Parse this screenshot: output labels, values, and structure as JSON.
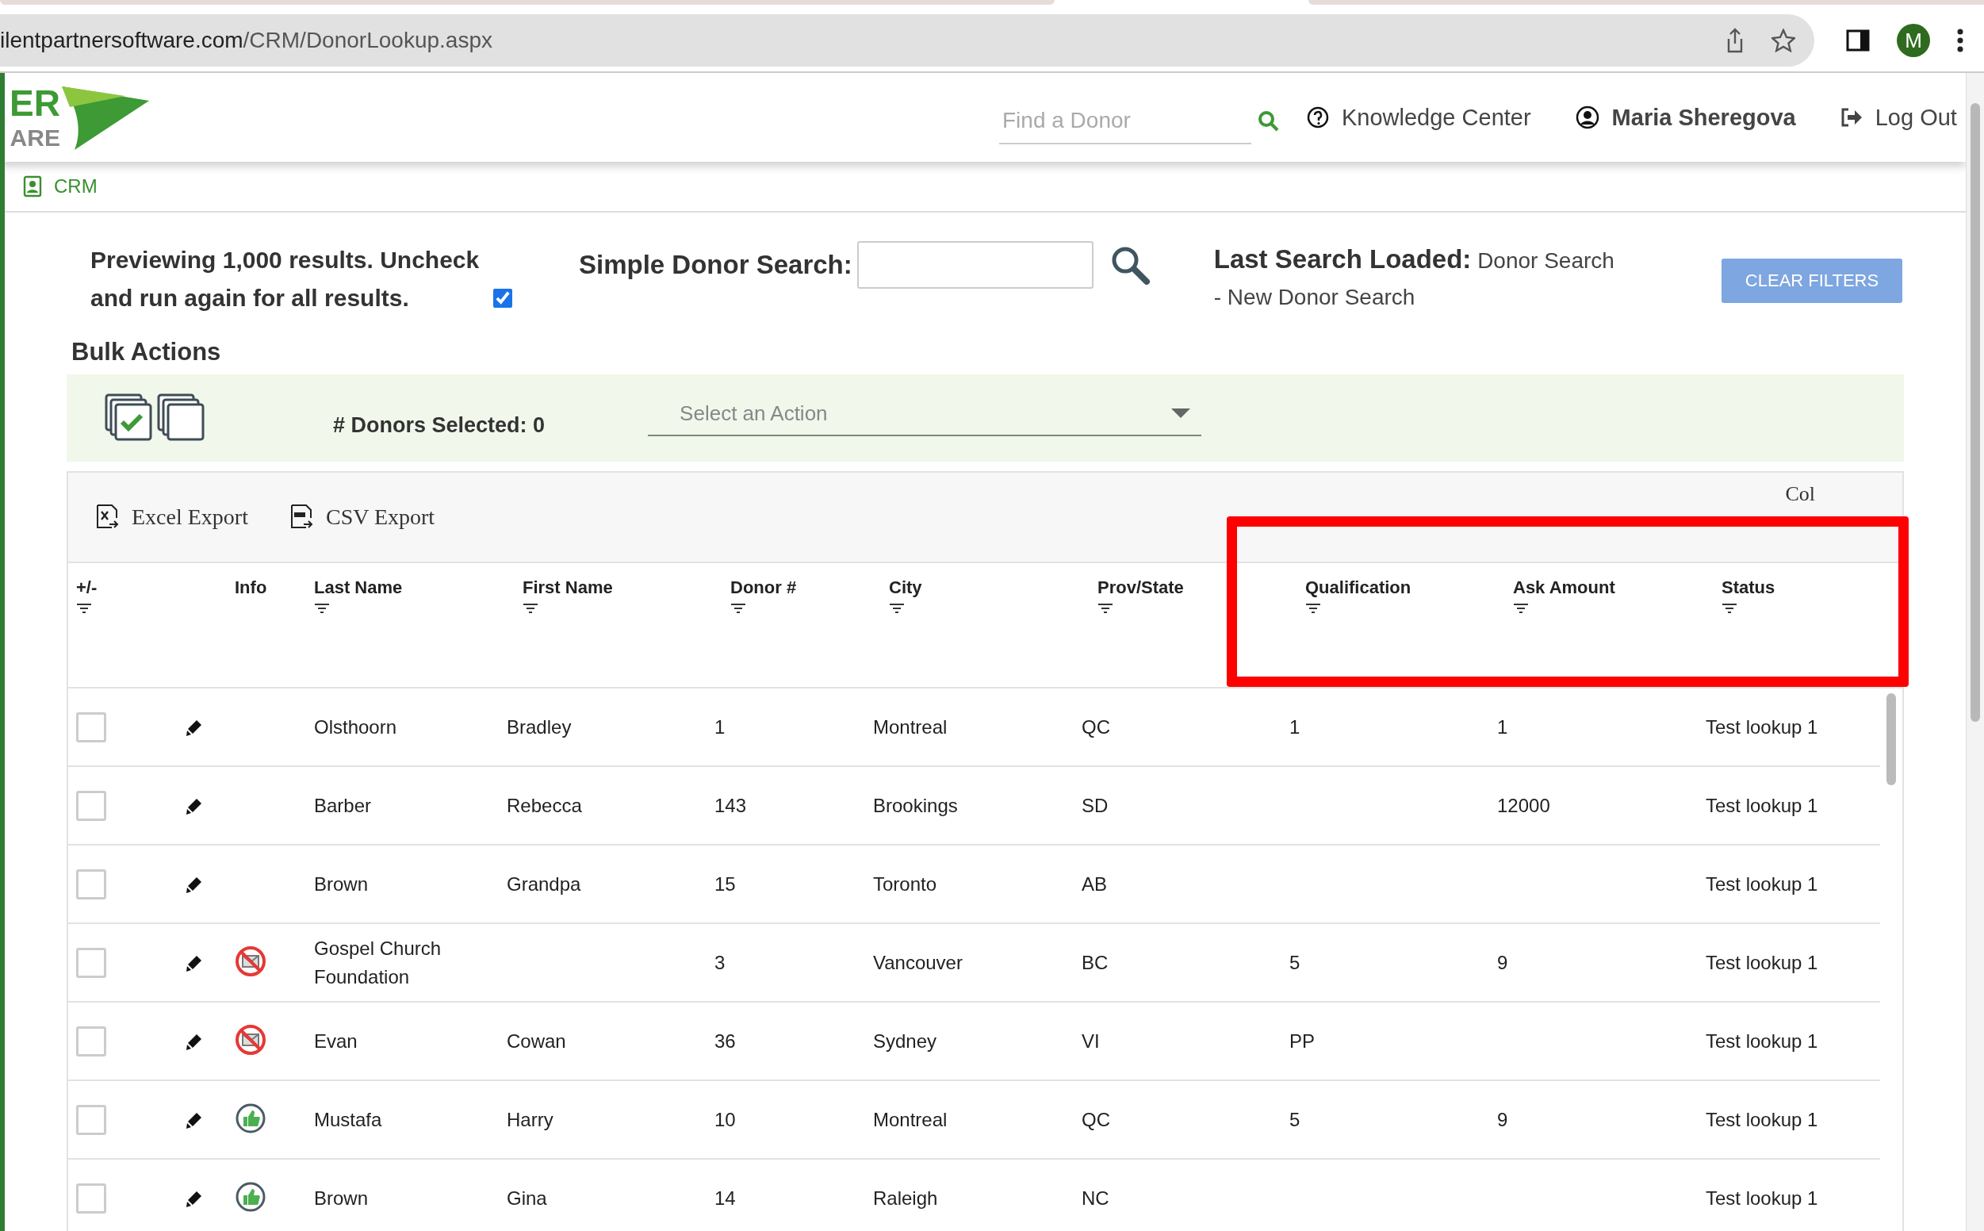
{
  "browser": {
    "url_host": "ilentpartnersoftware.com",
    "url_path": "/CRM/DonorLookup.aspx",
    "profile_initial": "M"
  },
  "header": {
    "logo_lines": [
      "ER",
      "ARE"
    ],
    "search": {
      "placeholder": "Find a Donor"
    },
    "links": [
      {
        "kind": "help",
        "label": "Knowledge Center"
      },
      {
        "kind": "user",
        "label": "Maria Sheregova"
      },
      {
        "kind": "logout",
        "label": "Log Out"
      }
    ]
  },
  "breadcrumb": "CRM",
  "preview": {
    "text": "Previewing 1,000 results. Uncheck and run again for all results.",
    "checked": true
  },
  "simple_search": {
    "label": "Simple Donor Search:"
  },
  "last_search": {
    "label": "Last Search Loaded:",
    "value": "Donor Search - New Donor Search"
  },
  "clear_button": "CLEAR FILTERS",
  "bulk_actions": {
    "title": "Bulk Actions",
    "selected_count": "# Donors Selected: 0",
    "action_select": {
      "placeholder": "Select an Action"
    }
  },
  "grid": {
    "exports": [
      {
        "kind": "excel",
        "label": "Excel Export"
      },
      {
        "kind": "csv",
        "label": "CSV Export"
      }
    ],
    "column_chooser": "Col",
    "columns": [
      "+/-",
      "Info",
      "Last Name",
      "First Name",
      "Donor #",
      "City",
      "Prov/State",
      "Qualification",
      "Ask Amount",
      "Status"
    ],
    "rows": [
      {
        "checked": false,
        "kind": "none",
        "last_name": "Olsthoorn",
        "first_name": "Bradley",
        "donor": "1",
        "city": "Montreal",
        "prov": "QC",
        "qualification": "1",
        "ask_amount": "1",
        "status": "Test lookup 1"
      },
      {
        "checked": false,
        "kind": "none",
        "last_name": "Barber",
        "first_name": "Rebecca",
        "donor": "143",
        "city": "Brookings",
        "prov": "SD",
        "ask_amount": "12000",
        "status": "Test lookup 1"
      },
      {
        "checked": false,
        "kind": "none",
        "last_name": "Brown",
        "first_name": "Grandpa",
        "donor": "15",
        "city": "Toronto",
        "prov": "AB",
        "status": "Test lookup 1"
      },
      {
        "checked": false,
        "kind": "no-mail",
        "last_name": "Gospel Church Foundation",
        "donor": "3",
        "city": "Vancouver",
        "prov": "BC",
        "qualification": "5",
        "ask_amount": "9",
        "status": "Test lookup 1"
      },
      {
        "checked": false,
        "kind": "no-mail",
        "last_name": "Evan",
        "first_name": "Cowan",
        "donor": "36",
        "city": "Sydney",
        "prov": "VI",
        "qualification": "PP",
        "status": "Test lookup 1"
      },
      {
        "checked": false,
        "kind": "thumbs-up",
        "last_name": "Mustafa",
        "first_name": "Harry",
        "donor": "10",
        "city": "Montreal",
        "prov": "QC",
        "qualification": "5",
        "ask_amount": "9",
        "status": "Test lookup 1"
      },
      {
        "checked": false,
        "kind": "thumbs-up",
        "last_name": "Brown",
        "first_name": "Gina",
        "donor": "14",
        "city": "Raleigh",
        "prov": "NC",
        "status": "Test lookup 1"
      }
    ]
  }
}
